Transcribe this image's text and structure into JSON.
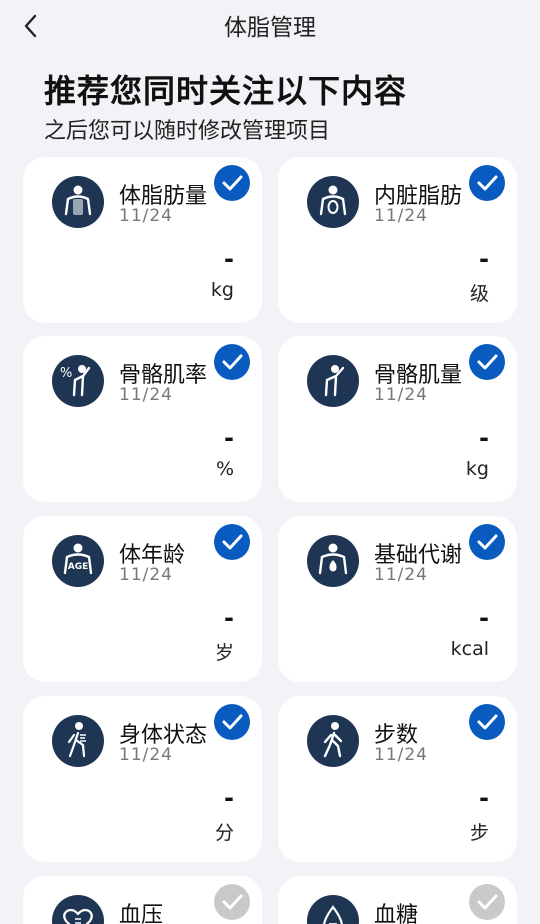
{
  "header": {
    "title": "体脂管理",
    "back_icon": "chevron-left-icon"
  },
  "intro": {
    "headline": "推荐您同时关注以下内容",
    "subline": "之后您可以随时修改管理项目"
  },
  "colors": {
    "accent": "#0a5bbf",
    "icon_bg": "#1e3553",
    "unchecked": "#c9c9c9",
    "background": "#f1f3f6"
  },
  "cards": [
    {
      "name": "体脂肪量",
      "date": "11/24",
      "value": "-",
      "unit": "kg",
      "icon": "body-fat-mass-icon",
      "checked": true
    },
    {
      "name": "内脏脂肪",
      "date": "11/24",
      "value": "-",
      "unit": "级",
      "icon": "visceral-fat-icon",
      "checked": true
    },
    {
      "name": "骨骼肌率",
      "date": "11/24",
      "value": "-",
      "unit": "%",
      "icon": "muscle-rate-icon",
      "checked": true
    },
    {
      "name": "骨骼肌量",
      "date": "11/24",
      "value": "-",
      "unit": "kg",
      "icon": "muscle-mass-icon",
      "checked": true
    },
    {
      "name": "体年龄",
      "date": "11/24",
      "value": "-",
      "unit": "岁",
      "icon": "body-age-icon",
      "checked": true
    },
    {
      "name": "基础代谢",
      "date": "11/24",
      "value": "-",
      "unit": "kcal",
      "icon": "basal-metabolism-icon",
      "checked": true
    },
    {
      "name": "身体状态",
      "date": "11/24",
      "value": "-",
      "unit": "分",
      "icon": "body-status-icon",
      "checked": true
    },
    {
      "name": "步数",
      "date": "11/24",
      "value": "-",
      "unit": "步",
      "icon": "steps-icon",
      "checked": true
    },
    {
      "name": "血压",
      "icon": "blood-pressure-icon",
      "checked": false
    },
    {
      "name": "血糖",
      "icon": "blood-sugar-icon",
      "checked": false
    }
  ]
}
